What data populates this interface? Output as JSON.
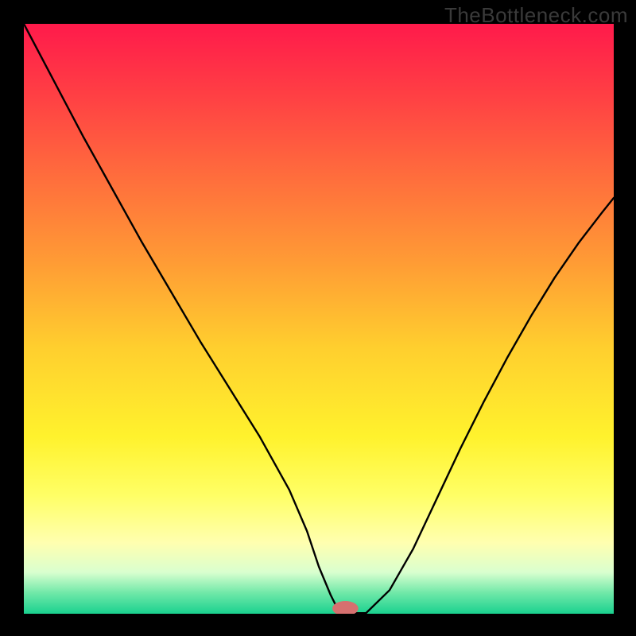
{
  "watermark": "TheBottleneck.com",
  "chart_data": {
    "type": "line",
    "title": "",
    "xlabel": "",
    "ylabel": "",
    "xlim": [
      0,
      100
    ],
    "ylim": [
      0,
      100
    ],
    "background": {
      "type": "vertical-gradient",
      "stops": [
        {
          "offset": 0.0,
          "color": "#ff1a4b"
        },
        {
          "offset": 0.12,
          "color": "#ff3f44"
        },
        {
          "offset": 0.25,
          "color": "#ff6a3d"
        },
        {
          "offset": 0.4,
          "color": "#ff9a35"
        },
        {
          "offset": 0.55,
          "color": "#ffcf2e"
        },
        {
          "offset": 0.7,
          "color": "#fff22d"
        },
        {
          "offset": 0.8,
          "color": "#ffff66"
        },
        {
          "offset": 0.88,
          "color": "#ffffb0"
        },
        {
          "offset": 0.93,
          "color": "#d9ffcf"
        },
        {
          "offset": 0.965,
          "color": "#6fe8a8"
        },
        {
          "offset": 1.0,
          "color": "#1ad18f"
        }
      ]
    },
    "series": [
      {
        "name": "bottleneck-curve",
        "stroke": "#000000",
        "stroke_width": 2.4,
        "x": [
          0,
          5,
          10,
          15,
          20,
          25,
          30,
          35,
          40,
          45,
          48,
          50,
          52,
          53,
          54,
          55,
          58,
          62,
          66,
          70,
          74,
          78,
          82,
          86,
          90,
          94,
          98,
          100
        ],
        "y": [
          100,
          90.5,
          81,
          72,
          63,
          54.5,
          46,
          38,
          30,
          21,
          14,
          8,
          3.2,
          1.2,
          0.1,
          0.1,
          0.1,
          4,
          11,
          19.5,
          28,
          36,
          43.5,
          50.5,
          57,
          62.8,
          68,
          70.5
        ]
      }
    ],
    "marker": {
      "name": "optimum-marker",
      "x": 54.5,
      "y": 0.9,
      "rx": 2.2,
      "ry": 1.25,
      "fill": "#d6706f"
    }
  }
}
